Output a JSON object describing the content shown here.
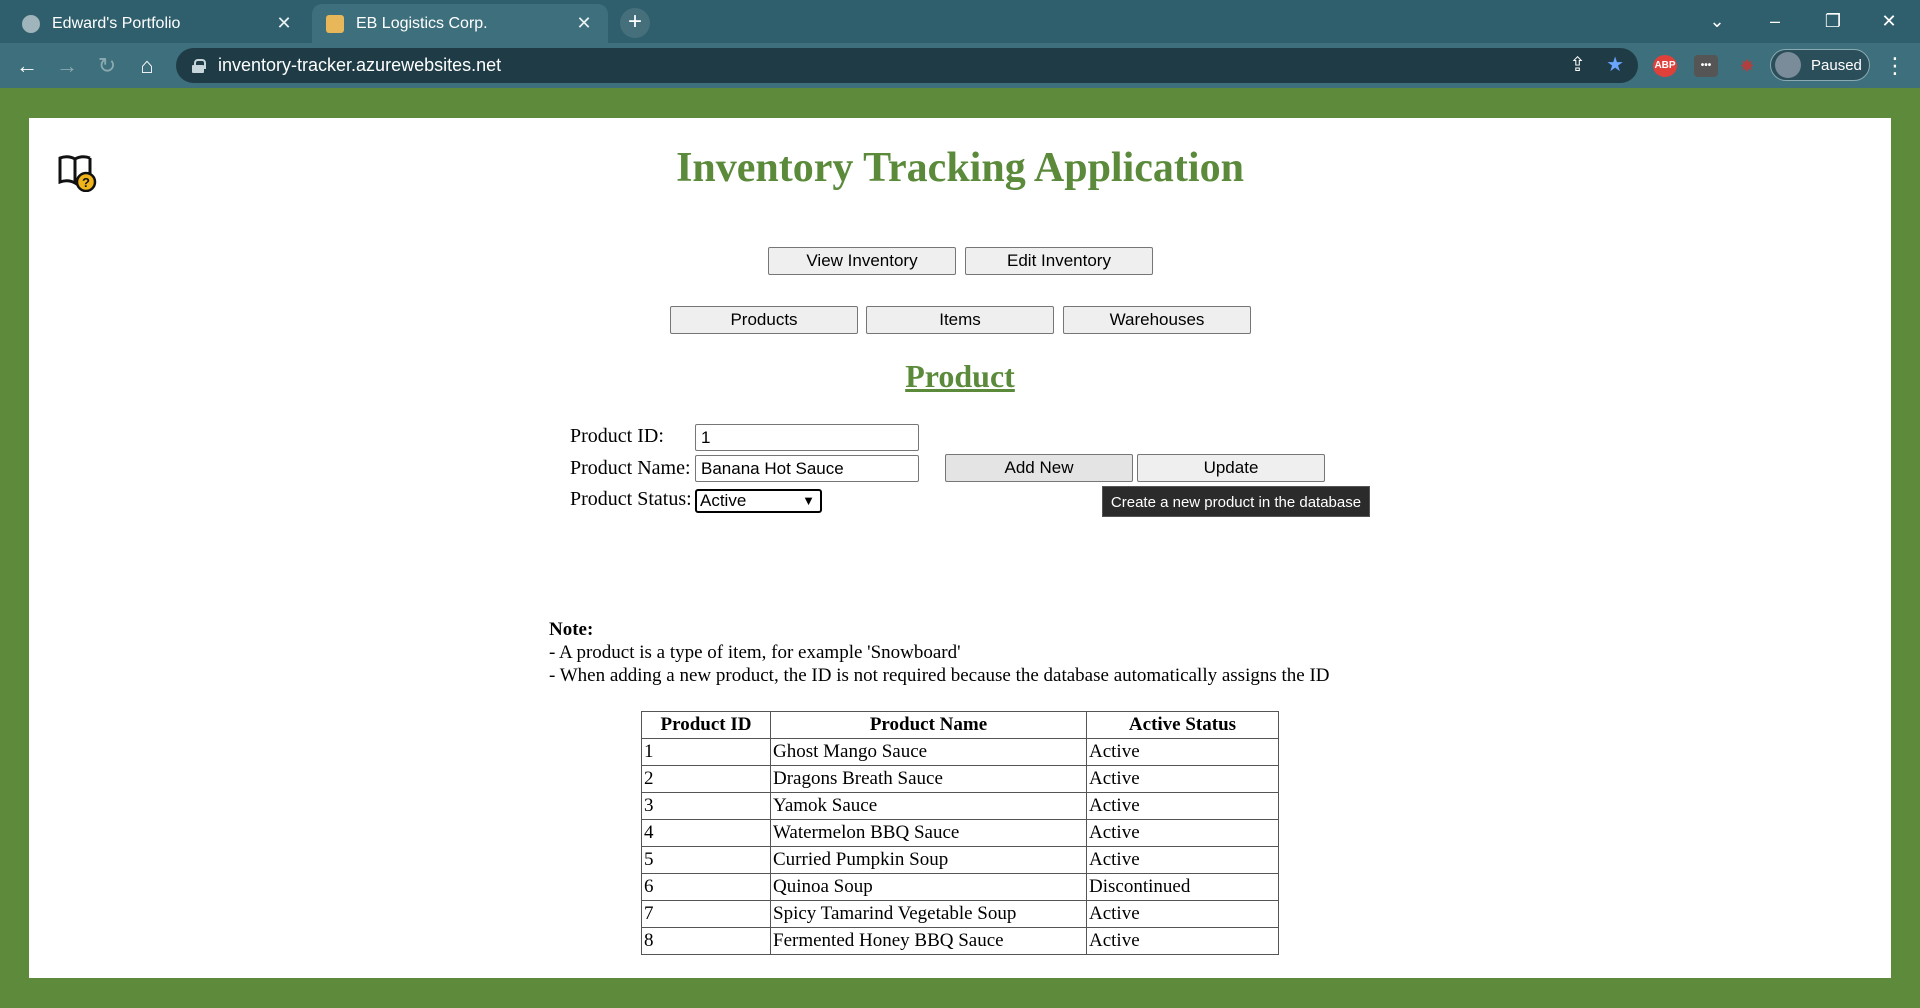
{
  "browser": {
    "tabs": [
      {
        "title": "Edward's Portfolio",
        "active": false
      },
      {
        "title": "EB Logistics Corp.",
        "active": true
      }
    ],
    "url": "inventory-tracker.azurewebsites.net",
    "profile_status": "Paused",
    "extension_abp": "ABP"
  },
  "app": {
    "title": "Inventory Tracking Application",
    "nav_primary": [
      "View Inventory",
      "Edit Inventory"
    ],
    "nav_secondary": [
      "Products",
      "Items",
      "Warehouses"
    ],
    "section_title": "Product"
  },
  "form": {
    "id_label": "Product ID:",
    "id_value": "1",
    "name_label": "Product Name:",
    "name_value": "Banana Hot Sauce",
    "status_label": "Product Status:",
    "status_value": "Active",
    "add_new_label": "Add New",
    "update_label": "Update",
    "tooltip": "Create a new product in the database"
  },
  "note": {
    "heading": "Note:",
    "lines": [
      "- A product is a type of item, for example 'Snowboard'",
      "- When adding a new product, the ID is not required because the database automatically assigns the ID"
    ]
  },
  "table": {
    "headers": [
      "Product ID",
      "Product Name",
      "Active Status"
    ],
    "rows": [
      [
        "1",
        "Ghost Mango Sauce",
        "Active"
      ],
      [
        "2",
        "Dragons Breath Sauce",
        "Active"
      ],
      [
        "3",
        "Yamok Sauce",
        "Active"
      ],
      [
        "4",
        "Watermelon BBQ Sauce",
        "Active"
      ],
      [
        "5",
        "Curried Pumpkin Soup",
        "Active"
      ],
      [
        "6",
        "Quinoa Soup",
        "Discontinued"
      ],
      [
        "7",
        "Spicy Tamarind Vegetable Soup",
        "Active"
      ],
      [
        "8",
        "Fermented Honey BBQ Sauce",
        "Active"
      ]
    ]
  },
  "colors": {
    "accent_green": "#5a8a3a",
    "page_border": "#5e8a3c",
    "chrome_teal": "#3d6f7c"
  },
  "icons": {
    "page_help": "book-question-icon",
    "omnibox": [
      "share-icon",
      "star-icon"
    ]
  }
}
